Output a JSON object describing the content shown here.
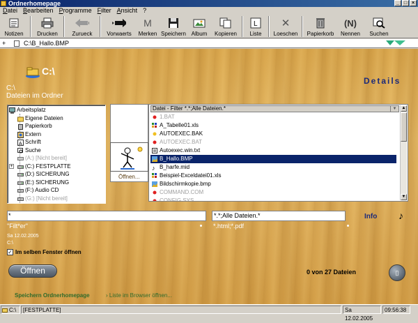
{
  "window": {
    "title": "Ordnerhomepage"
  },
  "menu": [
    {
      "label": "Datei",
      "ul": "D"
    },
    {
      "label": "Bearbeiten",
      "ul": "B"
    },
    {
      "label": "Programme",
      "ul": "P"
    },
    {
      "label": "Filter",
      "ul": "F"
    },
    {
      "label": "Ansicht",
      "ul": "A"
    },
    {
      "label": "?",
      "ul": ""
    }
  ],
  "toolbar": {
    "notizen": "Notizen",
    "drucken": "Drucken",
    "zurueck": "Zurueck",
    "vorwaerts": "Vorwaerts",
    "merken": "Merken",
    "speichern": "Speichern",
    "album": "Album",
    "kopieren": "Kopieren",
    "liste": "Liste",
    "loeschen": "Loeschen",
    "papierkorb": "Papierkorb",
    "nennen": "Nennen",
    "suchen": "Suchen"
  },
  "address": {
    "plus": "+",
    "path": "C:\\B_Hallo.BMP"
  },
  "header": {
    "big_path": "C:\\",
    "details_label": "Details",
    "small_path": "C:\\",
    "files_in_folder": "Dateien im Ordner"
  },
  "tree": [
    {
      "label": "Arbeitsplatz",
      "icon": "computer-icon",
      "level": 0,
      "dim": false
    },
    {
      "label": "Eigene Dateien",
      "icon": "folder-icon",
      "level": 1,
      "dim": false
    },
    {
      "label": "Papierkorb",
      "icon": "recycle-bin-icon",
      "level": 1,
      "dim": false
    },
    {
      "label": "Extern",
      "icon": "external-icon",
      "level": 1,
      "dim": false
    },
    {
      "label": "Schrift",
      "icon": "font-icon",
      "level": 1,
      "dim": false
    },
    {
      "label": "Suche",
      "icon": "search-icon",
      "level": 1,
      "dim": false
    },
    {
      "label": "(A:) [Nicht bereit]",
      "icon": "floppy-icon",
      "level": 1,
      "dim": true
    },
    {
      "label": "(C:) FESTPLATTE",
      "icon": "drive-icon",
      "level": 1,
      "dim": false,
      "expand": "+"
    },
    {
      "label": "(D:) SICHERUNG",
      "icon": "drive-icon",
      "level": 1,
      "dim": false
    },
    {
      "label": "(E:) SICHERUNG",
      "icon": "drive-icon",
      "level": 1,
      "dim": false
    },
    {
      "label": "(F:) Audio CD",
      "icon": "cd-icon",
      "level": 1,
      "dim": false
    },
    {
      "label": "(G:) [Nicht bereit]",
      "icon": "cd-icon",
      "level": 1,
      "dim": true
    }
  ],
  "preview": {
    "open_label": "Öffnen..."
  },
  "filelist": {
    "filter_header": "Datei - Filter *.*;Alle Dateien.*",
    "files": [
      {
        "name": "1.BAT",
        "icon": "red-dot-icon",
        "dim": true,
        "selected": false
      },
      {
        "name": "A_Tabelle01.xls",
        "icon": "spreadsheet-icon",
        "dim": false,
        "selected": false
      },
      {
        "name": "AUTOEXEC.BAK",
        "icon": "yellow-dot-icon",
        "dim": false,
        "selected": false
      },
      {
        "name": "AUTOEXEC.BAT",
        "icon": "red-dot-icon",
        "dim": true,
        "selected": false
      },
      {
        "name": "Autoexec.win.txt",
        "icon": "text-file-icon",
        "dim": false,
        "selected": false
      },
      {
        "name": "B_Hallo.BMP",
        "icon": "image-icon",
        "dim": false,
        "selected": true
      },
      {
        "name": "B_harfe.mid",
        "icon": "music-note-icon",
        "dim": false,
        "selected": false
      },
      {
        "name": "Beispiel-Exceldatei01.xls",
        "icon": "spreadsheet-icon",
        "dim": false,
        "selected": false
      },
      {
        "name": "Bildschirmkopie.bmp",
        "icon": "image-icon",
        "dim": false,
        "selected": false
      },
      {
        "name": "COMMAND.COM",
        "icon": "red-dot-icon",
        "dim": true,
        "selected": false
      },
      {
        "name": "CONFIG.SYS",
        "icon": "red-dot-icon",
        "dim": true,
        "selected": false
      }
    ]
  },
  "filter": {
    "value": "*",
    "hint": "\"Filt*er\"",
    "type_value": "*.*;Alle Dateien.*",
    "type_hint": "*.html;*.pdf",
    "info_label": "Info"
  },
  "meta": {
    "date_small": "Sa 12.02.2005",
    "c_small": "C:\\"
  },
  "same_window": {
    "label": "Im selben Fenster öffnen",
    "checked": true
  },
  "actions": {
    "open_label": "Öffnen",
    "count_text": "0 von 27 Dateien",
    "save_link": "Speichern  Ordnerhomepage",
    "list_link": "Liste im Browser öffnen..."
  },
  "statusbar": {
    "drive": "C:\\",
    "label": "[FESTPLATTE]",
    "date": "Sa 12.02.2005",
    "time": "09:56:38"
  },
  "colors": {
    "selection": "#0a246a",
    "details_text": "#1c2a7a",
    "link_green": "#2f6b2b",
    "wood_base": "#dfae58"
  }
}
